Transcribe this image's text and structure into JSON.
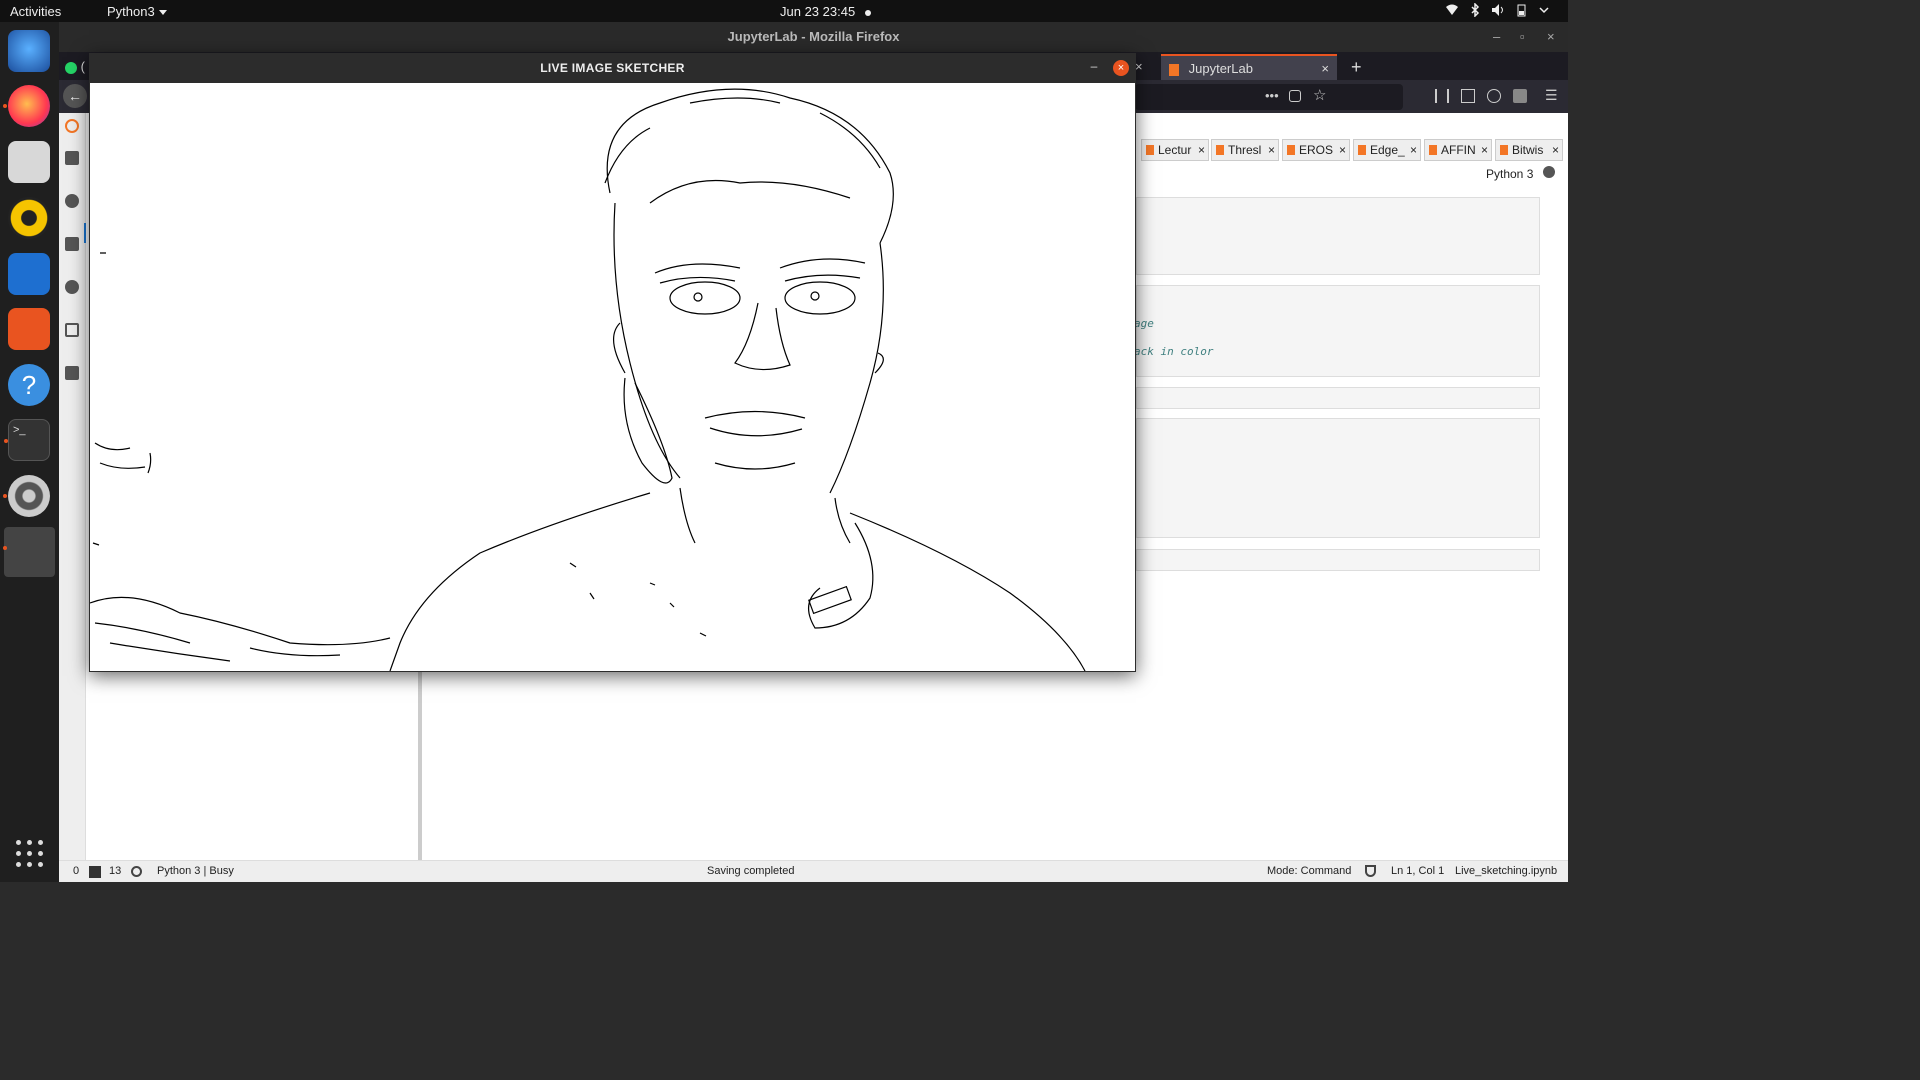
{
  "topbar": {
    "activities": "Activities",
    "app_menu": "Python3",
    "clock": "Jun 23  23:45",
    "tray_icons": [
      "wifi-icon",
      "bluetooth-icon",
      "volume-icon",
      "battery-icon",
      "power-menu-icon"
    ]
  },
  "dock": {
    "items": [
      "thunderbird-icon",
      "firefox-icon",
      "files-icon",
      "rhythmbox-icon",
      "writer-icon",
      "software-icon",
      "help-icon",
      "terminal-icon",
      "settings-icon",
      "window-thumbnail"
    ],
    "apps_grid_icon": "show-applications-icon"
  },
  "firefox": {
    "window_title": "JupyterLab - Mozilla Firefox",
    "tabs": [
      {
        "label": "("
      },
      {
        "label": "JupyterLab",
        "active": true
      }
    ],
    "new_tab_label": "+"
  },
  "jupyter": {
    "notebook_tabs": [
      {
        "label": "Lectur"
      },
      {
        "label": "Thresl"
      },
      {
        "label": "EROS"
      },
      {
        "label": "Edge_"
      },
      {
        "label": "AFFIN"
      },
      {
        "label": "Bitwis"
      }
    ],
    "kernel": "Python 3",
    "code_fragments": [
      "age",
      "ack in color"
    ],
    "status": {
      "terminals": "0",
      "kernels": "13",
      "kernel_status": "Python 3 | Busy",
      "message": "Saving completed",
      "mode": "Mode: Command",
      "cursor": "Ln 1, Col 1",
      "filename": "Live_sketching.ipynb"
    }
  },
  "cv_window": {
    "title": "LIVE IMAGE SKETCHER",
    "minimize": "–",
    "close": "×"
  },
  "colors": {
    "accent": "#e95420",
    "topbar": "#111111",
    "jupyter_orange": "#f37626"
  }
}
